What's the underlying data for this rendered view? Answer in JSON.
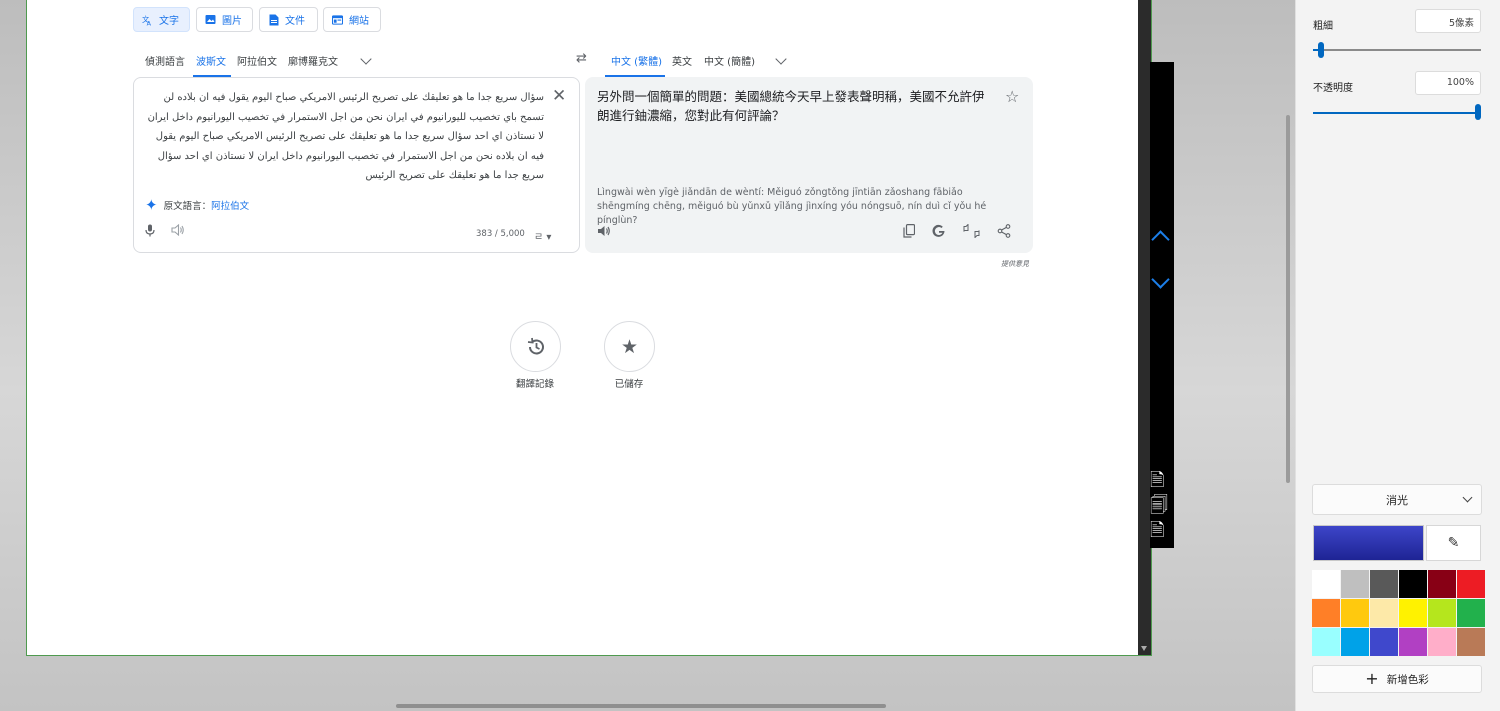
{
  "tabs": [
    {
      "label": "文字",
      "icon": "translate-icon",
      "active": true
    },
    {
      "label": "圖片",
      "icon": "image-icon",
      "active": false
    },
    {
      "label": "文件",
      "icon": "document-icon",
      "active": false
    },
    {
      "label": "網站",
      "icon": "website-icon",
      "active": false
    }
  ],
  "source_langs": [
    "偵測語言",
    "波斯文",
    "阿拉伯文",
    "廓博羅克文"
  ],
  "target_langs": [
    "中文 (繁體)",
    "英文",
    "中文 (簡體)"
  ],
  "source": {
    "text": "سؤال سريع جدا ما هو تعليقك على تصريح الرئيس الامريكي صباح اليوم يقول فيه ان بلاده لن تسمح باي تخصيب لليورانيوم في ايران نحن من اجل الاستمرار في تخصيب اليورانيوم داخل ايران لا نستاذن اي احد سؤال سريع جدا ما هو تعليقك على تصريح الرئيس الامريكي صباح اليوم يقول فيه ان بلاده نحن من اجل الاستمرار في تخصيب اليورانيوم داخل ايران لا نستاذن اي احد سؤال سريع جدا ما هو تعليقك على تصريح الرئيس",
    "detected_prefix": "原文語言：",
    "detected_lang": "阿拉伯文",
    "counter": "383 / 5,000"
  },
  "target": {
    "text": "另外問一個簡單的問題：美國總統今天早上發表聲明稱，美國不允許伊朗進行鈾濃縮，您對此有何評論？",
    "romanized": "Lìngwài wèn yīgè jiǎndān de wèntí: Měiguó zǒngtǒng jīntiān zǎoshang fābiǎo shēngmíng chēng, měiguó bù yǔnxǔ yīlǎng jìnxíng yóu nóngsuō, nín duì cǐ yǒu hé pínglùn?",
    "feedback": "提供意見"
  },
  "history_label": "翻譯記錄",
  "saved_label": "已儲存",
  "panel": {
    "thickness_label": "粗細",
    "thickness_value": "5像素",
    "thickness_level": 0.05,
    "opacity_label": "不透明度",
    "opacity_value": "100%",
    "opacity_level": 1.0,
    "effect_value": "消光",
    "current_color": "#2b33b0",
    "add_color_label": "新增色彩",
    "swatches": [
      "#ffffff",
      "#bfbfbf",
      "#595959",
      "#000000",
      "#880015",
      "#ed1c24",
      "#ff7f27",
      "#ffc90e",
      "#fde9a8",
      "#fff200",
      "#b5e61d",
      "#22b14c",
      "#99ffff",
      "#00a2e8",
      "#3f48cc",
      "#b140c3",
      "#ffaec9",
      "#b97a57"
    ]
  }
}
